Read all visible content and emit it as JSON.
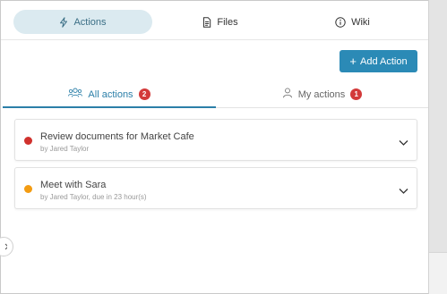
{
  "top_tabs": [
    {
      "label": "Actions",
      "icon": "bolt-icon"
    },
    {
      "label": "Files",
      "icon": "document-icon"
    },
    {
      "label": "Wiki",
      "icon": "info-icon"
    }
  ],
  "add_action_label": "Add Action",
  "sub_tabs": [
    {
      "label": "All actions",
      "count": "2",
      "icon": "people-icon"
    },
    {
      "label": "My actions",
      "count": "1",
      "icon": "person-icon"
    }
  ],
  "actions": [
    {
      "title": "Review documents for Market Cafe",
      "meta": "by Jared Taylor",
      "status_color": "#d0312d"
    },
    {
      "title": "Meet with Sara",
      "meta": "by Jared Taylor, due in 23 hour(s)",
      "status_color": "#f39c12"
    }
  ],
  "colors": {
    "accent": "#2b8ab6",
    "active_tab_bg": "#dbeaf0",
    "badge": "#d33a3a"
  }
}
